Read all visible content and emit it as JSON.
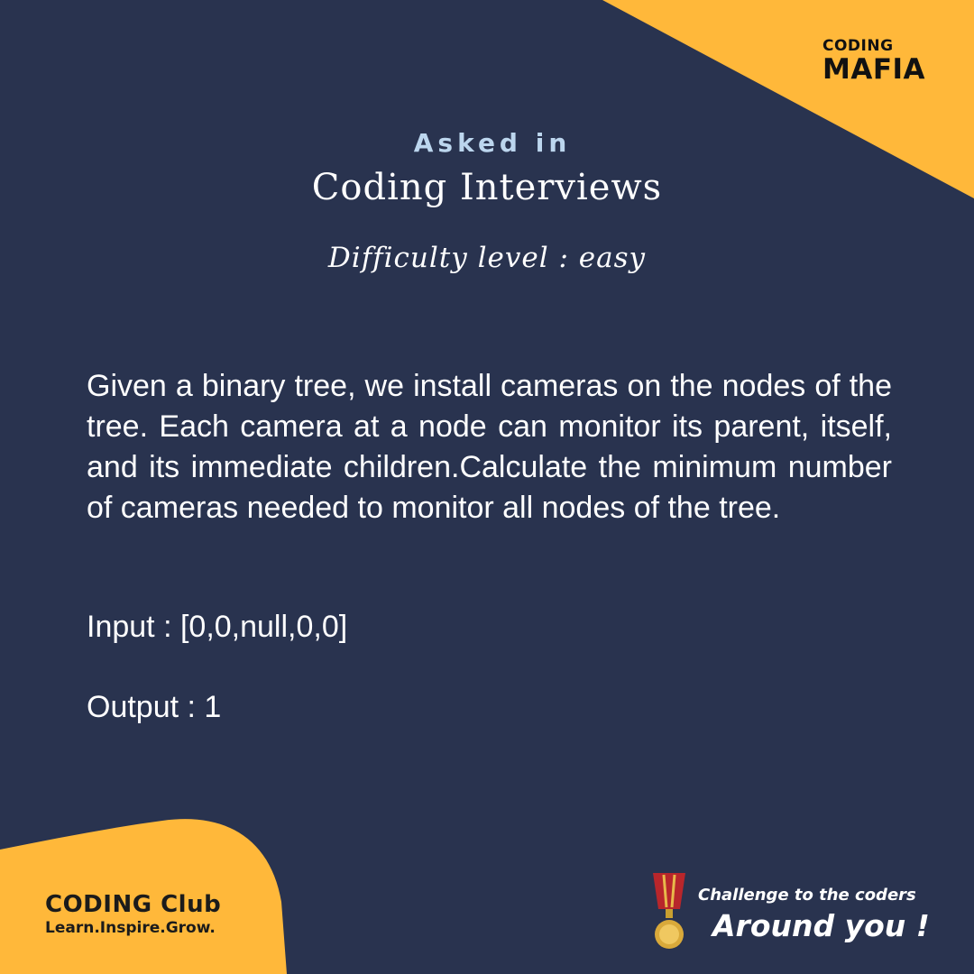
{
  "colors": {
    "background": "#29334f",
    "accent": "#ffb83a",
    "subheading": "#bcd6ee",
    "text": "#ffffff"
  },
  "brand": {
    "top_logo_line1": "CODING",
    "top_logo_line2": "MAFIA",
    "club_name": "CODING Club",
    "club_tagline": "Learn.Inspire.Grow."
  },
  "header": {
    "asked_in": "Asked in",
    "title": "Coding Interviews",
    "difficulty": "Difficulty level : easy"
  },
  "problem": {
    "statement": "Given a binary tree, we install cameras on the nodes of the tree. Each camera at a node can monitor its parent, itself, and its immediate children.Calculate the minimum number of cameras needed to monitor all nodes of the tree.",
    "input": "Input : [0,0,null,0,0]",
    "output": "Output : 1"
  },
  "footer": {
    "challenge_line1": "Challenge to the coders",
    "challenge_line2": "Around you !",
    "medal_icon": "medal-icon"
  }
}
